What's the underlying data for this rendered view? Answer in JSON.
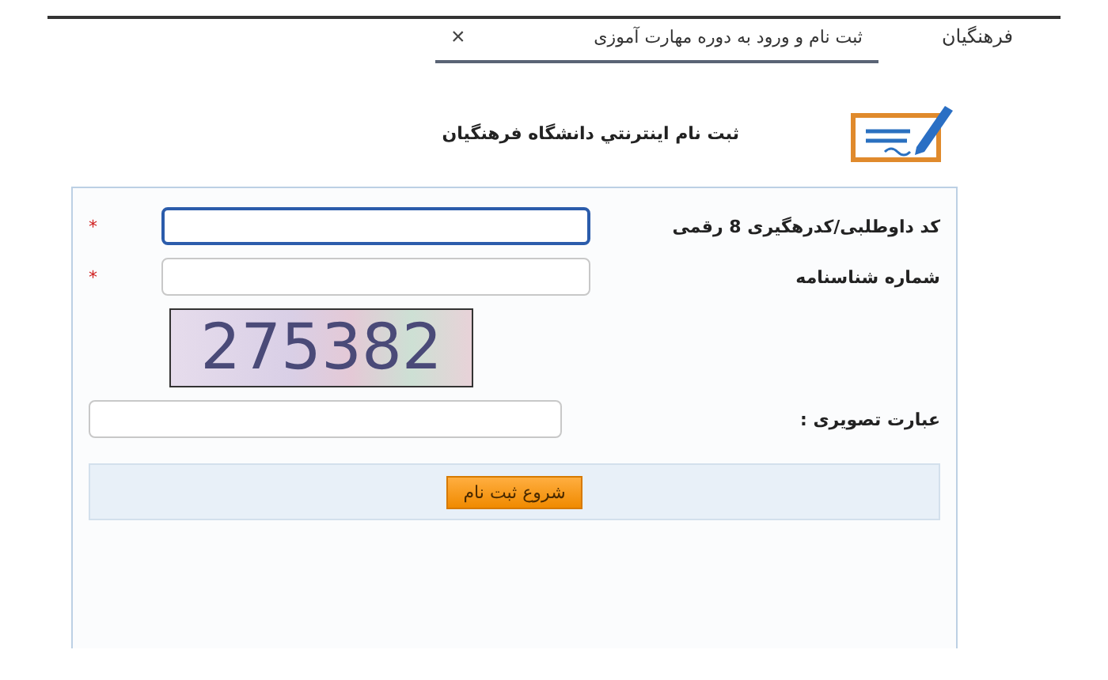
{
  "top_bar": {
    "site_name": "فرهنگیان",
    "tab": {
      "label": "ثبت نام و ورود به دوره مهارت آموزی",
      "close": "×",
      "selected": true
    }
  },
  "header": {
    "title": "ثبت نام اینترنتي دانشگاه فرهنگیان"
  },
  "form": {
    "fields": [
      {
        "kind": "input",
        "label": "کد داوطلبی/کدرهگیری 8 رقمی",
        "required_mark": "*",
        "focused": true
      },
      {
        "kind": "input",
        "label": "شماره شناسنامه",
        "required_mark": "*",
        "focused": false
      },
      {
        "kind": "captcha",
        "code": "275382"
      },
      {
        "kind": "input",
        "label": "عبارت تصویری :",
        "focused": false
      }
    ],
    "submit": "شروع ثبت نام"
  }
}
